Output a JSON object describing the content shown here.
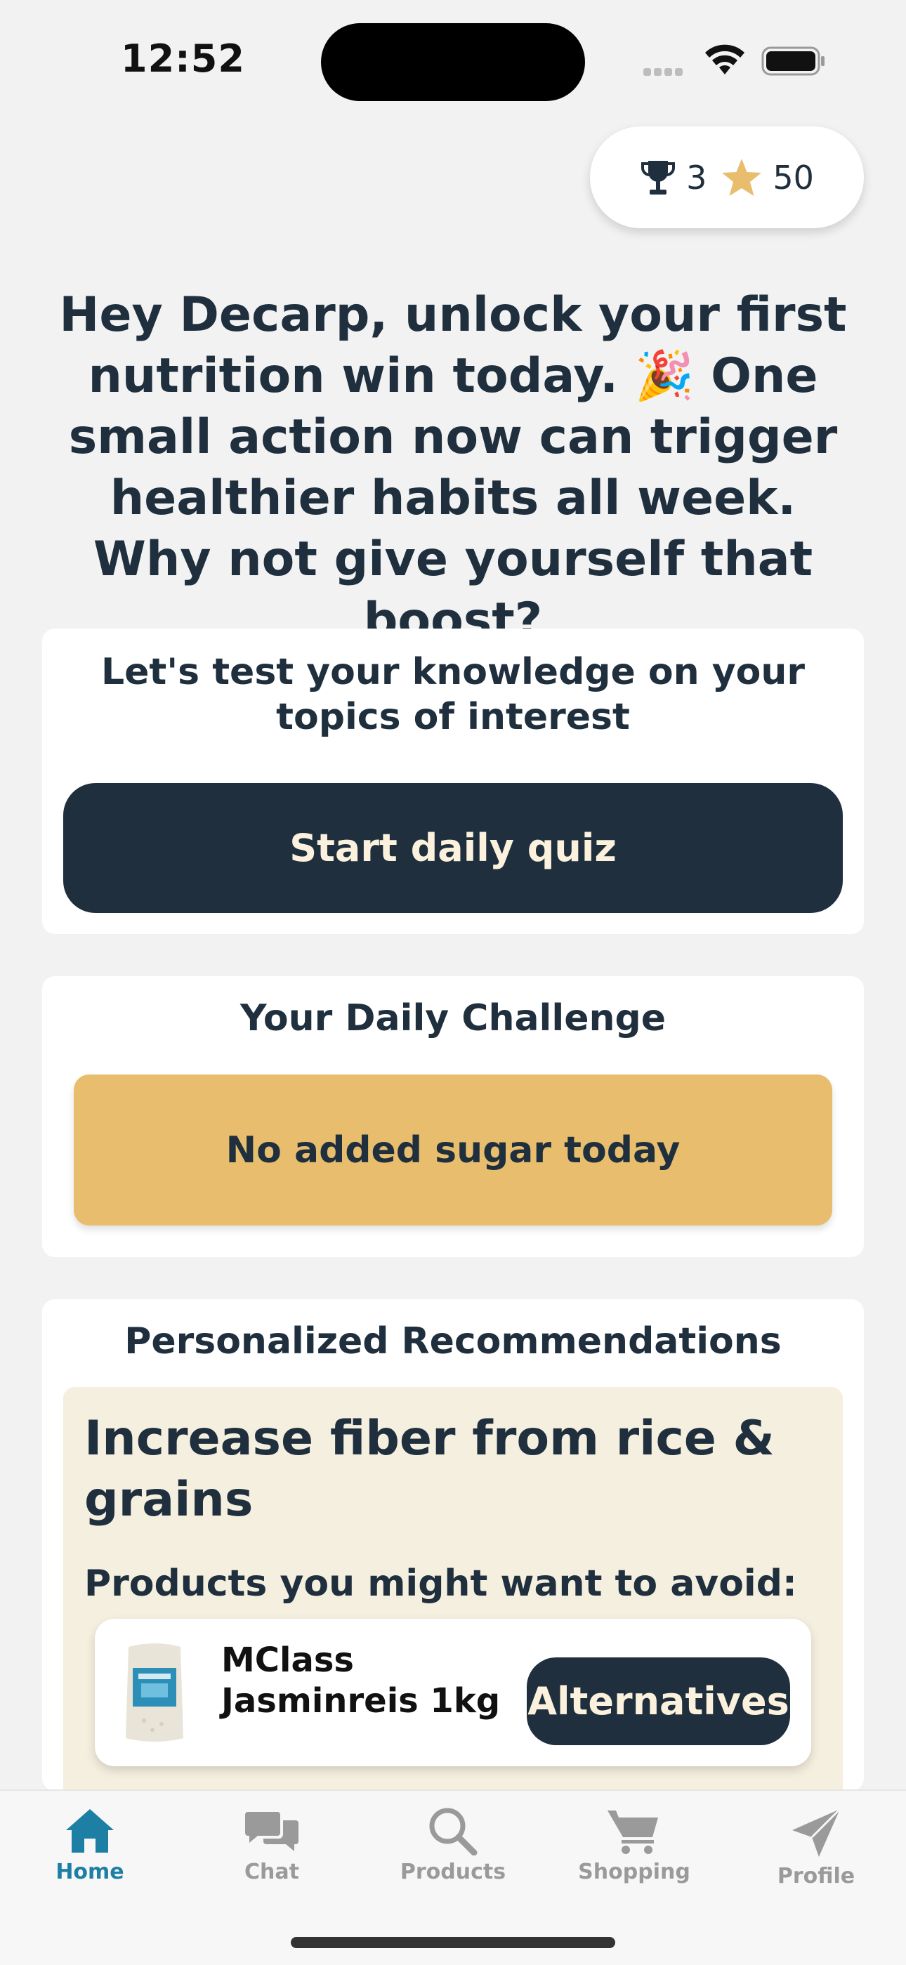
{
  "status_bar": {
    "time": "12:52"
  },
  "rewards": {
    "trophies": "3",
    "stars": "50",
    "trophy_icon": "trophy-icon",
    "star_icon": "star-icon",
    "star_color": "#E8BD6D"
  },
  "headline": "Hey Decarp, unlock your first nutrition win today. 🎉 One small action now can trigger healthier habits all week. Why not give yourself that boost?",
  "quiz": {
    "prompt": "Let's test your knowledge on your topics of interest",
    "button_label": "Start daily quiz"
  },
  "challenge": {
    "title": "Your Daily Challenge",
    "value": "No added sugar today"
  },
  "recommendations": {
    "title": "Personalized Recommendations",
    "heading": "Increase fiber from rice & grains",
    "subheading": "Products you might want to avoid:",
    "products": [
      {
        "name": "MClass Jasminreis 1kg",
        "action_label": "Alternatives"
      }
    ]
  },
  "tabs": [
    {
      "label": "Home",
      "icon": "home-icon",
      "active": true
    },
    {
      "label": "Chat",
      "icon": "chat-icon",
      "active": false
    },
    {
      "label": "Products",
      "icon": "search-icon",
      "active": false
    },
    {
      "label": "Shopping",
      "icon": "cart-icon",
      "active": false
    },
    {
      "label": "Profile",
      "icon": "paper-plane-icon",
      "active": false
    }
  ],
  "colors": {
    "primary": "#1F2F3D",
    "accent": "#E8BD6D",
    "tab_active": "#1C7FA3",
    "reco_background": "#F5EFDF"
  }
}
